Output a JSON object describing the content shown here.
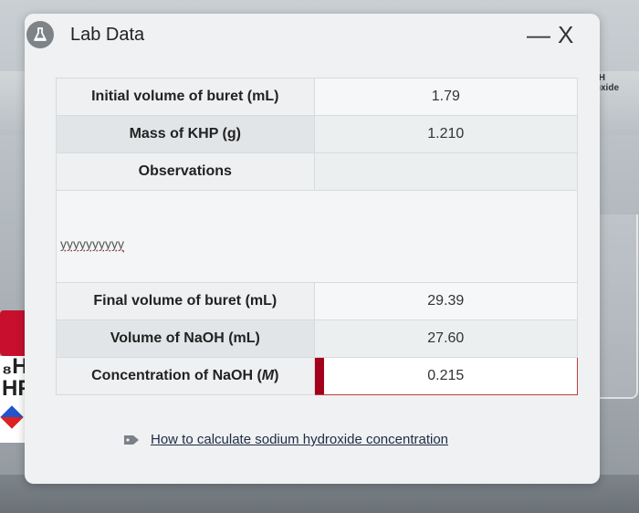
{
  "window": {
    "title": "Lab Data",
    "minimize_glyph": "—",
    "close_glyph": "X"
  },
  "background": {
    "bottle_label_top": "OH",
    "bottle_label_bottom": "roxide",
    "khp_label_top": "₈H",
    "khp_label_bottom": "HF"
  },
  "rows": [
    {
      "label": "Initial volume of buret (mL)",
      "value": "1.79"
    },
    {
      "label": "Mass of KHP (g)",
      "value": "1.210"
    }
  ],
  "observations": {
    "label": "Observations",
    "text": "yyyyyyyyyy"
  },
  "rows2": [
    {
      "label": "Final volume of buret (mL)",
      "value": "29.39"
    },
    {
      "label": "Volume of NaOH (mL)",
      "value": "27.60"
    }
  ],
  "concentration": {
    "label_prefix": "Concentration of NaOH (",
    "label_unit": "M",
    "label_suffix": ")",
    "value": "0.215"
  },
  "help_link": "How to calculate sodium hydroxide concentration",
  "colors": {
    "accent_red": "#a3001d",
    "app_icon_bg": "#7d8387"
  }
}
